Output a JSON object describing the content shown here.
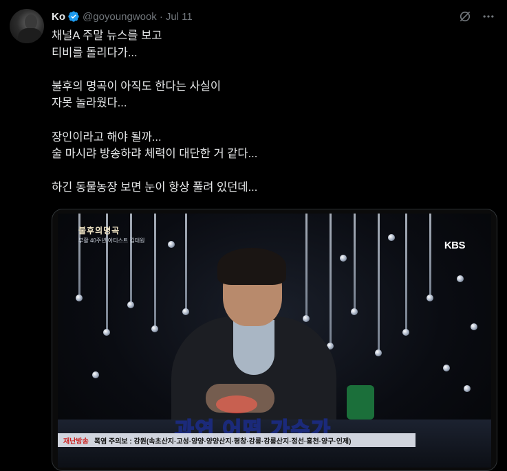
{
  "tweet": {
    "display_name": "Ko",
    "handle": "@goyoungwook",
    "separator": "·",
    "date": "Jul 11",
    "text": "채널A 주말 뉴스를 보고\n티비를 돌리다가...\n\n불후의 명곡이 아직도 한다는 사실이\n자못 놀라웠다...\n\n장인이라고 해야 될까...\n술 마시랴 방송하랴 체력이 대단한 거 같다...\n\n하긴 동물농장 보면 눈이 항상 풀려 있던데..."
  },
  "media": {
    "show_logo": "불후의명곡",
    "show_subtitle": "부활 40주년 아티스트 김태원",
    "channel_logo": "KBS",
    "caption": "과연 어떤 가수가",
    "ticker_label": "재난방송",
    "ticker_text": "폭염 주의보 : 강원(속초산지·고성·양양·양양산지·평창·강릉·강릉산지·정선·홍천·양구·인제)"
  },
  "icons": {
    "verified": "verified-badge-icon",
    "grok": "grok-icon",
    "more": "more-icon"
  },
  "colors": {
    "background": "#000000",
    "text": "#e7e9ea",
    "muted": "#71767b",
    "verified": "#1d9bf0"
  }
}
